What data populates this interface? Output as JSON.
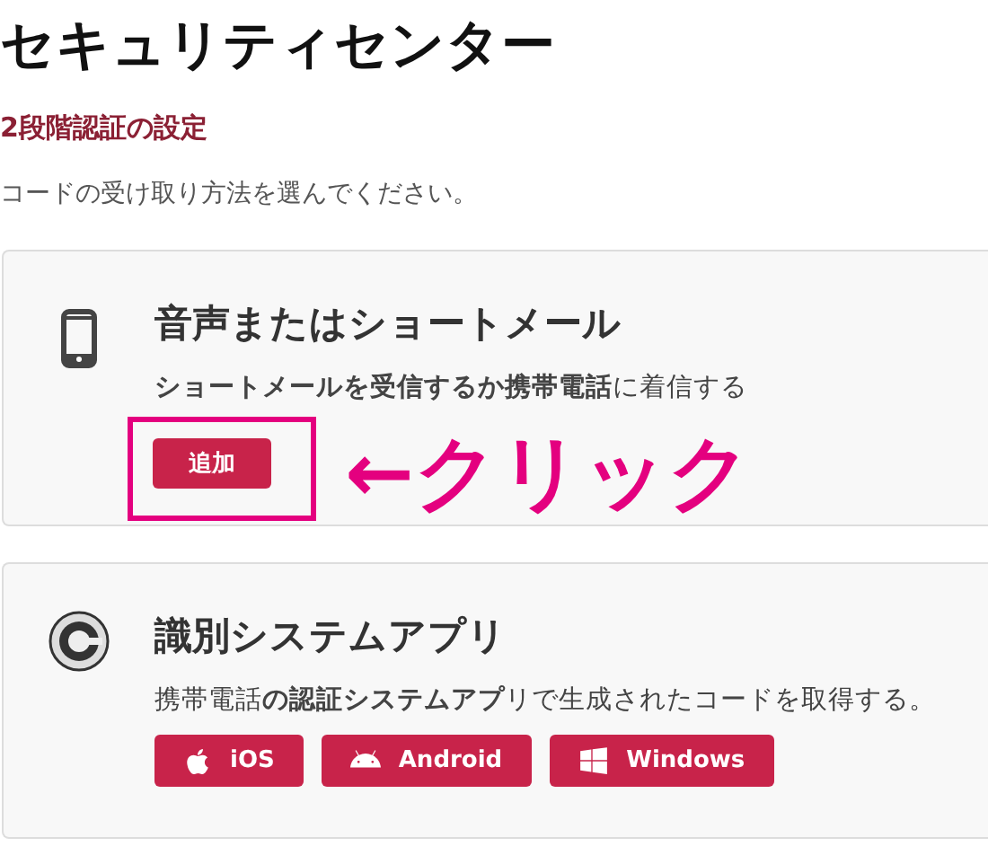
{
  "page_title": "セキュリティセンター",
  "section_title": "2段階認証の設定",
  "intro": "コードの受け取り方法を選んでください。",
  "methods": [
    {
      "kind": "phone",
      "title": "音声またはショートメール",
      "description": "**ショートメールを受信するか携帯電話**に着信する",
      "buttons": [
        {
          "kind": "add",
          "label": "追加"
        }
      ],
      "annotation": {
        "label": "←クリック"
      }
    },
    {
      "kind": "authenticator",
      "title": "識別システムアプリ",
      "description": "携帯電話**の認証システムアプ**リで生成されたコードを取得する。",
      "buttons": [
        {
          "kind": "apple",
          "label": "iOS"
        },
        {
          "kind": "android",
          "label": "Android"
        },
        {
          "kind": "windows",
          "label": "Windows"
        }
      ]
    }
  ]
}
